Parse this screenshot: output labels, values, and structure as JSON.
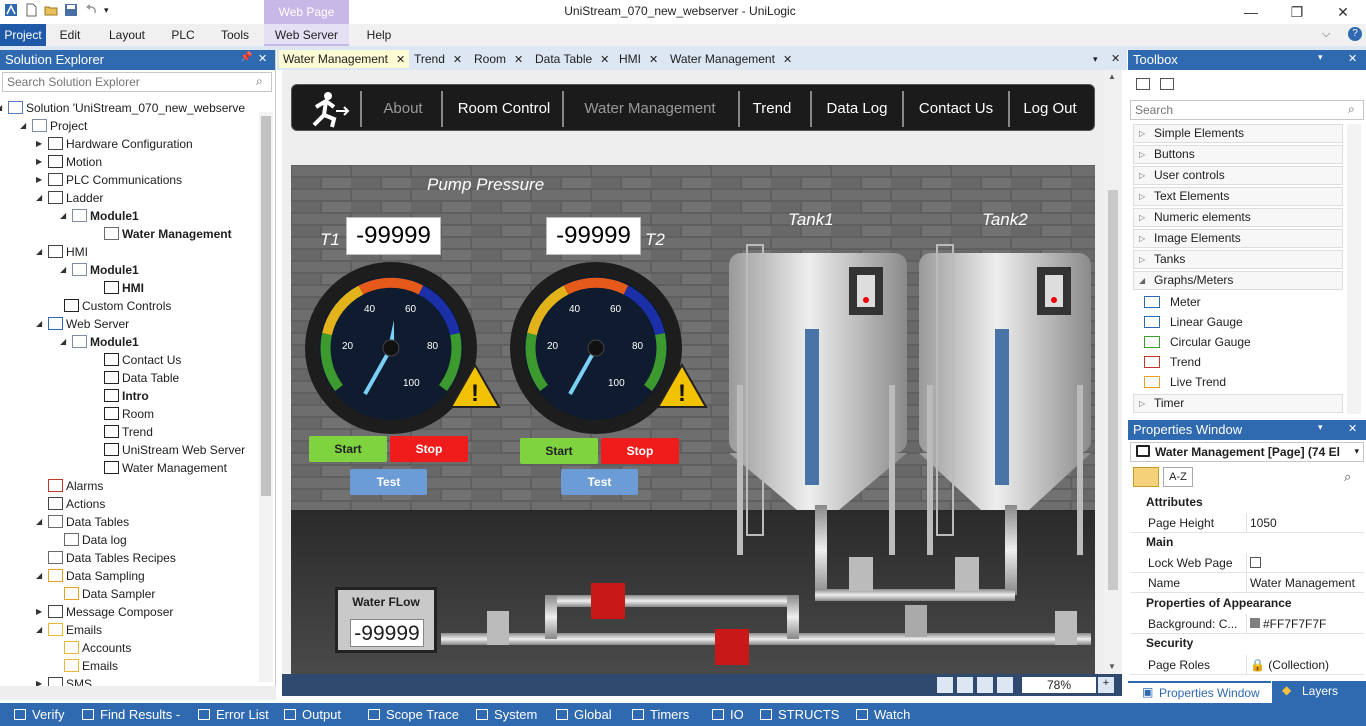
{
  "window": {
    "title": "UniStream_070_new_webserver - UniLogic",
    "context_tab": "Web Page",
    "buttons": {
      "minimize": "—",
      "maximize": "❐",
      "close": "✕"
    }
  },
  "menu": [
    "Project",
    "Edit",
    "Layout",
    "PLC",
    "Tools",
    "Web Server",
    "Help"
  ],
  "solution_explorer": {
    "title": "Solution Explorer",
    "search_placeholder": "Search Solution Explorer",
    "items": [
      "Solution 'UniStream_070_new_webserve",
      "Project",
      "Hardware Configuration",
      "Motion",
      "PLC Communications",
      "Ladder",
      "Module1",
      "Water Management",
      "HMI",
      "Module1",
      "HMI",
      "Custom Controls",
      "Web Server",
      "Module1",
      "Contact Us",
      "Data Table",
      "Intro",
      "Room",
      "Trend",
      "UniStream Web Server",
      "Water Management",
      "Alarms",
      "Actions",
      "Data Tables",
      "Data log",
      "Data Tables Recipes",
      "Data Sampling",
      "Data Sampler",
      "Message Composer",
      "Emails",
      "Accounts",
      "Emails",
      "SMS"
    ]
  },
  "doc_tabs": [
    "Water Management",
    "Trend",
    "Room",
    "Data Table",
    "HMI",
    "Water Management"
  ],
  "page": {
    "nav": [
      "About",
      "Room Control",
      "Water Management",
      "Trend",
      "Data Log",
      "Contact Us",
      "Log Out"
    ],
    "pump_pressure": "Pump Pressure",
    "t1_label": "T1",
    "t2_label": "T2",
    "t1_value": "-99999",
    "t2_value": "-99999",
    "gauge_ticks": [
      "20",
      "40",
      "60",
      "80",
      "100"
    ],
    "start": "Start",
    "stop": "Stop",
    "test": "Test",
    "tank1": "Tank1",
    "tank2": "Tank2",
    "water_flow_label": "Water FLow",
    "water_flow_value": "-99999"
  },
  "zoom": "78%",
  "toolbox": {
    "title": "Toolbox",
    "search_placeholder": "Search",
    "categories": [
      "Simple Elements",
      "Buttons",
      "User controls",
      "Text Elements",
      "Numeric elements",
      "Image Elements",
      "Tanks",
      "Graphs/Meters"
    ],
    "graph_items": [
      "Meter",
      "Linear Gauge",
      "Circular Gauge",
      "Trend",
      "Live Trend"
    ],
    "last_category": "Timer"
  },
  "properties": {
    "title": "Properties Window",
    "object": "Water Management [Page] (74 El",
    "az": "A-Z",
    "sections": {
      "attributes": "Attributes",
      "main": "Main",
      "appearance": "Properties of Appearance",
      "security": "Security"
    },
    "rows": {
      "page_height": {
        "k": "Page Height",
        "v": "1050"
      },
      "lock": {
        "k": "Lock Web Page",
        "v": ""
      },
      "name": {
        "k": "Name",
        "v": "Water Management"
      },
      "background": {
        "k": "Background: C...",
        "v": "#FF7F7F7F"
      },
      "roles": {
        "k": "Page Roles",
        "v": "(Collection)"
      }
    },
    "tabs": [
      "Properties Window",
      "Layers"
    ]
  },
  "bottom_tabs": [
    "Verify",
    "Find Results -",
    "Error List",
    "Output",
    "Scope Trace",
    "System",
    "Global",
    "Timers",
    "IO",
    "STRUCTS",
    "Watch"
  ],
  "colors": {
    "accent": "#2f6ab0",
    "context": "#c8b8e8",
    "start": "#7fd33f",
    "stop": "#f01c1c",
    "test": "#6c9cd6"
  }
}
